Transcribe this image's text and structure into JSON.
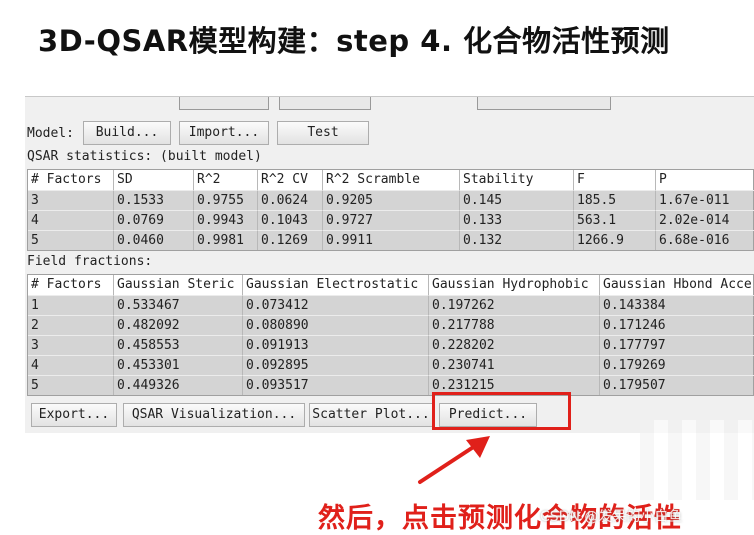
{
  "slide": {
    "title": "3D-QSAR模型构建：step 4. 化合物活性预测",
    "caption": "然后，点击预测化合物的活性",
    "watermark": "CSDN @发呆的小白鱼"
  },
  "model": {
    "label": "Model:",
    "build_label": "Build...",
    "import_label": "Import...",
    "test_label": "Test"
  },
  "qsar_stats": {
    "label": "QSAR statistics: (built model)",
    "columns": [
      "# Factors",
      "SD",
      "R^2",
      "R^2 CV",
      "R^2 Scramble",
      "Stability",
      "F",
      "P"
    ],
    "rows": [
      [
        "3",
        "0.1533",
        "0.9755",
        "0.0624",
        "0.9205",
        "0.145",
        "185.5",
        "1.67e-011"
      ],
      [
        "4",
        "0.0769",
        "0.9943",
        "0.1043",
        "0.9727",
        "0.133",
        "563.1",
        "2.02e-014"
      ],
      [
        "5",
        "0.0460",
        "0.9981",
        "0.1269",
        "0.9911",
        "0.132",
        "1266.9",
        "6.68e-016"
      ]
    ]
  },
  "field_fractions": {
    "label": "Field fractions:",
    "columns": [
      "# Factors",
      "Gaussian Steric",
      "Gaussian Electrostatic",
      "Gaussian Hydrophobic",
      "Gaussian Hbond Acce"
    ],
    "rows": [
      [
        "1",
        "0.533467",
        "0.073412",
        "0.197262",
        "0.143384"
      ],
      [
        "2",
        "0.482092",
        "0.080890",
        "0.217788",
        "0.171246"
      ],
      [
        "3",
        "0.458553",
        "0.091913",
        "0.228202",
        "0.177797"
      ],
      [
        "4",
        "0.453301",
        "0.092895",
        "0.230741",
        "0.179269"
      ],
      [
        "5",
        "0.449326",
        "0.093517",
        "0.231215",
        "0.179507"
      ]
    ]
  },
  "actions": {
    "export_label": "Export...",
    "visualization_label": "QSAR Visualization...",
    "scatter_label": "Scatter Plot...",
    "predict_label": "Predict..."
  },
  "colors": {
    "accent": "#e0201a",
    "grid_row": "#d4d4d4",
    "panel_bg": "#f0f0f0"
  }
}
